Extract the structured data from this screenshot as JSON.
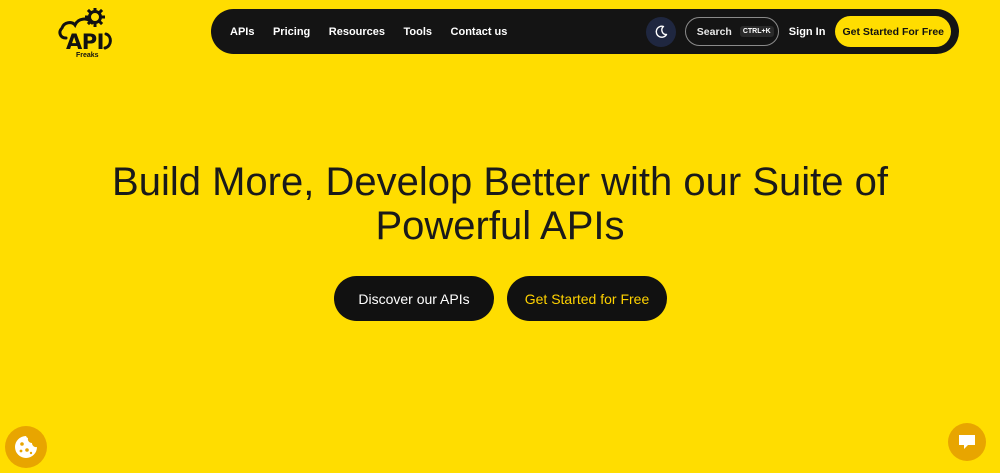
{
  "brand": {
    "logo_text": "API",
    "logo_subtext": "Freaks",
    "logo_icon": "gear-cloud-icon"
  },
  "nav": {
    "links": [
      "APIs",
      "Pricing",
      "Resources",
      "Tools",
      "Contact us"
    ],
    "theme_toggle_icon": "moon-icon",
    "search_label": "Search",
    "search_shortcut": "CTRL+K",
    "signin_label": "Sign In",
    "cta_label": "Get Started For Free"
  },
  "hero": {
    "title_line1": "Build More, Develop Better with our Suite of",
    "title_line2": "Powerful APIs",
    "discover_label": "Discover our APIs",
    "getstarted_label": "Get Started for Free"
  },
  "widgets": {
    "cookie_icon": "cookie-icon",
    "chat_icon": "chat-icon"
  },
  "colors": {
    "background": "#FFDD00",
    "navbar": "#141414",
    "button_dark": "#111111",
    "accent_text": "#FFD200",
    "widget": "#E8A500"
  }
}
